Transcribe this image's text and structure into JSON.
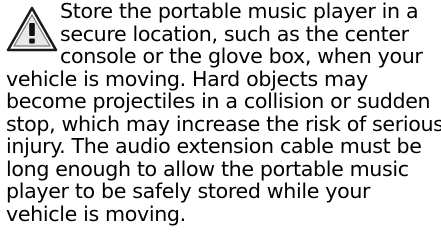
{
  "warning": {
    "icon": "warning-triangle-icon",
    "lines": [
      "Store the portable music player in a",
      "secure location, such as the center",
      "console or the glove box, when your",
      "vehicle is moving. Hard objects may",
      "become projectiles in a collision or sudden",
      "stop, which may increase the risk of serious",
      "injury. The audio extension cable must be",
      "long enough to allow the portable music",
      "player to be safely stored while your",
      "vehicle is moving."
    ]
  }
}
